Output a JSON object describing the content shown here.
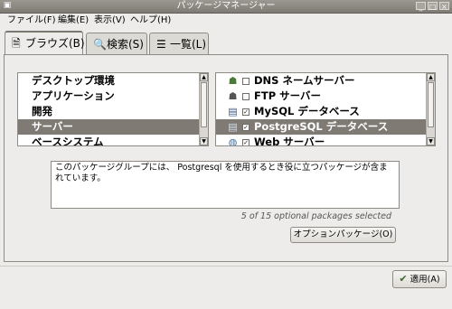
{
  "window": {
    "title": "パッケージマネージャー"
  },
  "menu": [
    "ファイル(F)",
    "編集(E)",
    "表示(V)",
    "ヘルプ(H)"
  ],
  "tabs": [
    {
      "label": "ブラウズ(B)",
      "icon": "browse-icon",
      "active": true
    },
    {
      "label": "検索(S)",
      "icon": "search-icon",
      "active": false
    },
    {
      "label": "一覧(L)",
      "icon": "list-icon",
      "active": false
    }
  ],
  "groups": [
    {
      "label": "デスクトップ環境"
    },
    {
      "label": "アプリケーション"
    },
    {
      "label": "開発"
    },
    {
      "label": "サーバー",
      "selected": true
    },
    {
      "label": "ベースシステム"
    }
  ],
  "packages": [
    {
      "label": "DNS ネームサーバー",
      "checked": false,
      "icon": "dns-icon"
    },
    {
      "label": "FTP サーバー",
      "checked": false,
      "icon": "ftp-icon"
    },
    {
      "label": "MySQL データベース",
      "checked": true,
      "icon": "database-icon"
    },
    {
      "label": "PostgreSQL データベース",
      "checked": true,
      "icon": "database-icon",
      "selected": true
    },
    {
      "label": "Web サーバー",
      "checked": true,
      "icon": "web-server-icon"
    }
  ],
  "description": "このパッケージグループには、 Postgresql を使用するとき役に立つパッケージが含まれています。",
  "count_text": "5 of 15 optional packages selected",
  "buttons": {
    "optional_packages": "オプションパッケージ(O)",
    "apply": "適用(A)"
  },
  "colors": {
    "selection": "#7f7a73",
    "window_bg": "#edeceb",
    "titlebar": "#8c8882"
  }
}
